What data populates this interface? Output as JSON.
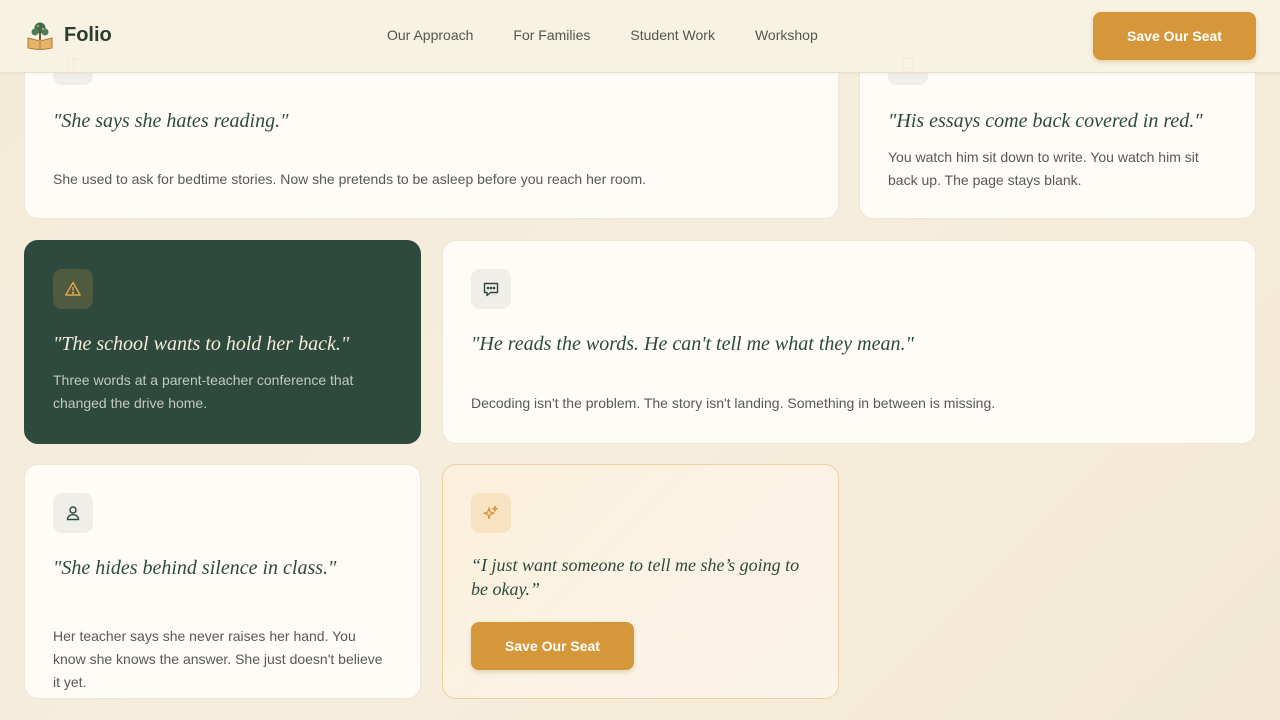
{
  "header": {
    "brand": "Folio",
    "nav": [
      "Our Approach",
      "For Families",
      "Student Work",
      "Workshop"
    ],
    "cta": "Save Our Seat"
  },
  "cards": [
    {
      "icon": "book-icon",
      "quote": "\"She says she hates reading.\"",
      "desc": "She used to ask for bedtime stories. Now she pretends to be asleep before you reach her room."
    },
    {
      "icon": "document-icon",
      "quote": "\"His essays come back covered in red.\"",
      "desc": "You watch him sit down to write. You watch him sit back up. The page stays blank."
    },
    {
      "icon": "warning-icon",
      "quote": "\"The school wants to hold her back.\"",
      "desc": "Three words at a parent-teacher conference that changed the drive home."
    },
    {
      "icon": "message-icon",
      "quote": "\"He reads the words. He can't tell me what they mean.\"",
      "desc": "Decoding isn't the problem. The story isn't landing. Something in between is missing."
    },
    {
      "icon": "user-icon",
      "quote": "\"She hides behind silence in class.\"",
      "desc": "Her teacher says she never raises her hand. You know she knows the answer. She just doesn't believe it yet."
    },
    {
      "icon": "sparkle-icon",
      "quote": "“I just want someone to tell me she’s going to be okay.”",
      "button": "Save Our Seat"
    }
  ],
  "colors": {
    "accent": "#d6973a",
    "dark_green": "#2e4a3e",
    "background": "#f3ead8"
  }
}
